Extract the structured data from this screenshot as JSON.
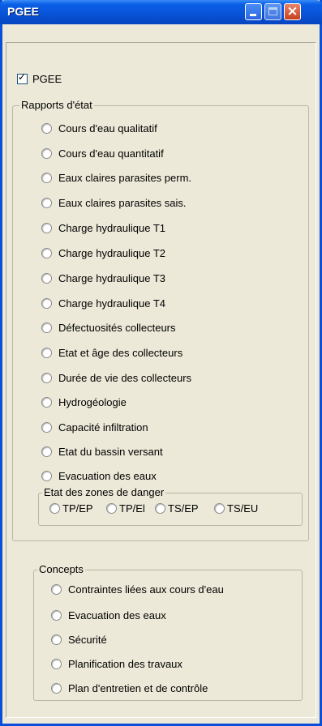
{
  "window": {
    "title": "PGEE"
  },
  "pgee_checkbox": {
    "label": "PGEE",
    "checked": true
  },
  "status_reports": {
    "legend": "Rapports d'état",
    "items": [
      "Cours d'eau qualitatif",
      "Cours d'eau quantitatif",
      "Eaux claires parasites perm.",
      "Eaux claires parasites sais.",
      "Charge hydraulique T1",
      "Charge hydraulique T2",
      "Charge hydraulique T3",
      "Charge hydraulique T4",
      "Défectuosités collecteurs",
      "Etat et âge des collecteurs",
      "Durée de vie des collecteurs",
      "Hydrogéologie",
      "Capacité infiltration",
      "Etat du bassin versant",
      "Evacuation des eaux"
    ],
    "danger_zones": {
      "legend": "Etat des zones de danger",
      "items": [
        "TP/EP",
        "TP/EU",
        "TS/EP",
        "TS/EU"
      ],
      "visible_labels": [
        "TP/EP",
        "TP/El",
        "TS/EP",
        "TS/EU"
      ]
    }
  },
  "concepts": {
    "legend": "Concepts",
    "items": [
      "Contraintes liées aux cours d'eau",
      "Evacuation des eaux",
      "Sécurité",
      "Planification des travaux",
      "Plan d'entretien et de contrôle"
    ]
  }
}
